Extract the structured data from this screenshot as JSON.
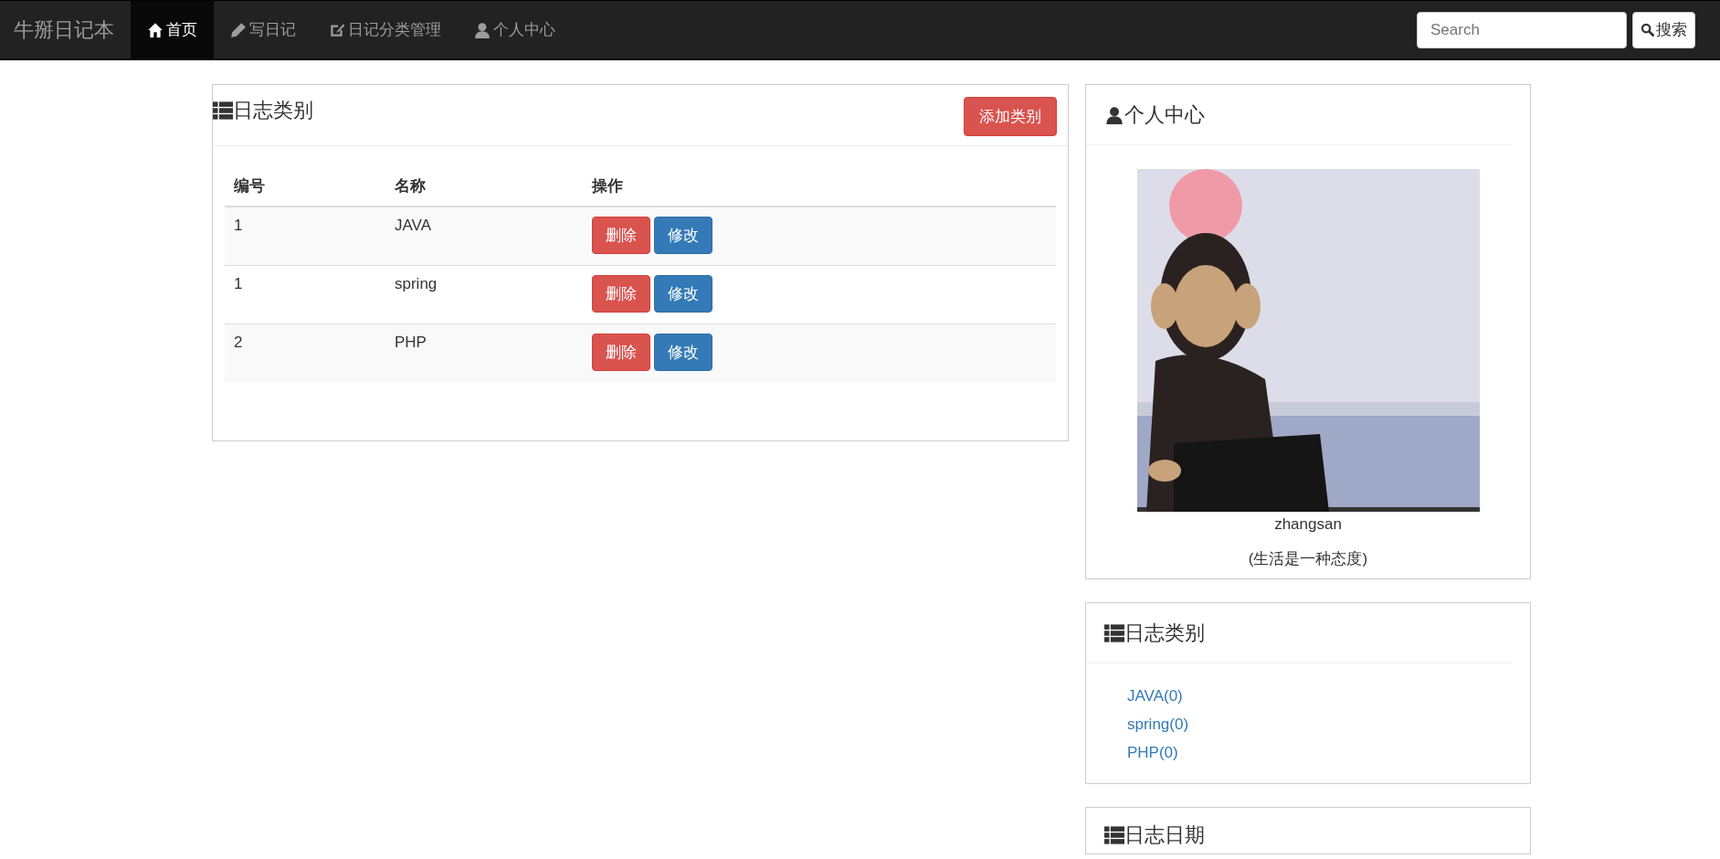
{
  "navbar": {
    "brand": "牛掰日记本",
    "links": [
      {
        "label": "首页",
        "selected": true
      },
      {
        "label": "写日记",
        "selected": false
      },
      {
        "label": "日记分类管理",
        "selected": false
      },
      {
        "label": "个人中心",
        "selected": false
      }
    ],
    "search": {
      "placeholder": "Search"
    },
    "search_button": "搜索"
  },
  "main_panel": {
    "title": "日志类别",
    "add_button": "添加类别",
    "table": {
      "columns": [
        "编号",
        "名称",
        "操作"
      ],
      "rows": [
        {
          "id": "1",
          "name": "JAVA",
          "actions": [
            "删除",
            "修改"
          ]
        },
        {
          "id": "1",
          "name": "spring",
          "actions": [
            "删除",
            "修改"
          ]
        },
        {
          "id": "2",
          "name": "PHP",
          "actions": [
            "删除",
            "修改"
          ]
        }
      ]
    }
  },
  "profile_panel": {
    "title": "个人中心",
    "username": "zhangsan",
    "motto": "(生活是一种态度)"
  },
  "category_panel": {
    "title": "日志类别",
    "items": [
      "JAVA(0)",
      "spring(0)",
      "PHP(0)"
    ]
  },
  "date_panel": {
    "title": "日志日期"
  }
}
